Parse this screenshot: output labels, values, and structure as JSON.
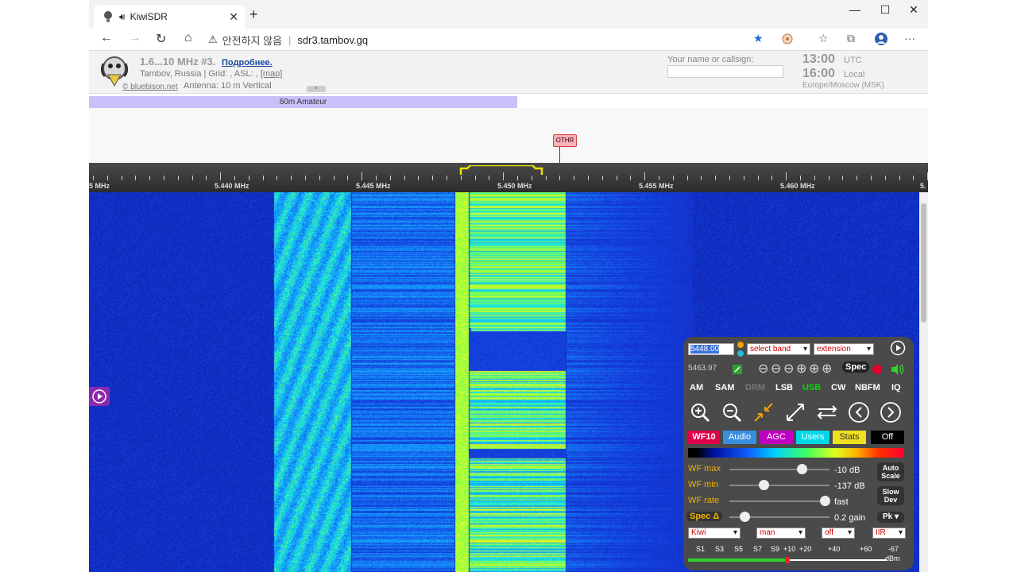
{
  "browser": {
    "tab_title": "KiwiSDR",
    "security_label": "안전하지 않음",
    "url": "sdr3.tambov.gq",
    "warning_glyph": "⚠",
    "close_glyph": "✕",
    "newtab_glyph": "+",
    "minimize_glyph": "—",
    "maximize_glyph": "☐",
    "winclose_glyph": "✕",
    "back_glyph": "←",
    "forward_glyph": "→",
    "reload_glyph": "↻",
    "home_glyph": "⌂",
    "star_glyph": "★",
    "favorites_glyph": "☆",
    "collections_glyph": "⧉",
    "more_glyph": "···"
  },
  "header": {
    "title": "1.6...10 MHz #3.",
    "more_link": "Подробнее.",
    "location": "Tambov, Russia | Grid: , ASL: , ",
    "map_link": "[map]",
    "copyright": "© bluebison.net",
    "antenna": "Antenna: 10 m Vertical",
    "toggle_glyph": "▾",
    "callsign_label": "Your name or callsign:",
    "callsign_value": "",
    "utc_time": "13:00",
    "utc_label": "UTC",
    "local_time": "16:00",
    "local_label": "Local",
    "timezone": "Europe/Moscow (MSK)"
  },
  "band": {
    "label": "60m Amateur"
  },
  "dx": {
    "label": "OTHR"
  },
  "scale": {
    "labels": [
      "5 MHz",
      "5.440 MHz",
      "5.445 MHz",
      "5.450 MHz",
      "5.455 MHz",
      "5.460 MHz",
      "5."
    ]
  },
  "panel": {
    "freq_value": "5448.00",
    "band_select": "select band",
    "extension_select": "extension",
    "last_freq": "5463.97",
    "zoom_buttons": [
      "⊖",
      "⊖",
      "⊖",
      "⊕",
      "⊕",
      "⊕"
    ],
    "spec_button": "Spec",
    "modes": [
      "AM",
      "SAM",
      "DRM",
      "LSB",
      "USB",
      "CW",
      "NBFM",
      "IQ"
    ],
    "active_mode": "USB",
    "tabs": {
      "wf10": "WF10",
      "audio": "Audio",
      "agc": "AGC",
      "users": "Users",
      "stats": "Stats",
      "off": "Off"
    },
    "wf_max_label": "WF max",
    "wf_max_value": "-10 dB",
    "wf_min_label": "WF min",
    "wf_min_value": "-137 dB",
    "wf_rate_label": "WF rate",
    "wf_rate_value": "fast",
    "spec_delta_label": "Spec Δ",
    "spec_delta_value": "0.2 gain",
    "auto_scale": "Auto Scale",
    "slow_dev": "Slow Dev",
    "pk_label": "Pk ▾",
    "bottom_selects": [
      "Kiwi",
      "man",
      "off",
      "IIR"
    ],
    "smeter_labels": [
      "S1",
      "S3",
      "S5",
      "S7",
      "S9",
      "+10",
      "+20",
      "+40",
      "+60",
      "-67"
    ],
    "smeter_unit": "dBm",
    "sliders": {
      "wf_max": 0.72,
      "wf_min": 0.34,
      "wf_rate": 0.95,
      "spec_delta": 0.15
    },
    "colors": {
      "accent_green": "#00e000",
      "wf10_bg": "#e0004a",
      "audio_bg": "#3a8ee0",
      "agc_bg": "#c000c0",
      "users_bg": "#00d8e8",
      "stats_bg": "#f0e020"
    }
  }
}
